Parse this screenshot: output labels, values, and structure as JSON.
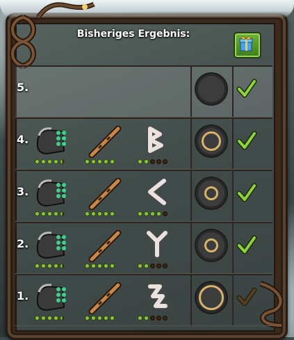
{
  "panel": {
    "title": "Bisheriges Ergebnis:"
  },
  "rows": [
    {
      "label": "5.",
      "blank": true,
      "checked": true
    },
    {
      "label": "4.",
      "rune": "rune-b-icon",
      "tool_dots": [
        2,
        2,
        2,
        2,
        1
      ],
      "staff_dots": [
        2,
        2,
        2,
        2,
        2
      ],
      "rune_dots": [
        2,
        2,
        0,
        0,
        0
      ],
      "ring": "small",
      "checked": true
    },
    {
      "label": "3.",
      "rune": "rune-c-icon",
      "tool_dots": [
        2,
        2,
        2,
        2,
        1
      ],
      "staff_dots": [
        2,
        2,
        2,
        2,
        2
      ],
      "rune_dots": [
        2,
        2,
        2,
        2,
        0
      ],
      "ring": "tiny",
      "checked": true
    },
    {
      "label": "2.",
      "rune": "rune-y-icon",
      "tool_dots": [
        2,
        2,
        2,
        2,
        1
      ],
      "staff_dots": [
        2,
        2,
        2,
        2,
        2
      ],
      "rune_dots": [
        2,
        2,
        0,
        0,
        0
      ],
      "ring": "tiny",
      "checked": true
    },
    {
      "label": "1.",
      "rune": "rune-s-icon",
      "tool_dots": [
        2,
        2,
        2,
        2,
        1
      ],
      "staff_dots": [
        2,
        2,
        2,
        2,
        2
      ],
      "rune_dots": [
        2,
        2,
        0,
        0,
        0
      ],
      "ring": "large",
      "checked": false
    }
  ],
  "colors": {
    "dot_on": "#8bc53a",
    "dot_off": "#3a2414",
    "check_on": "#8fd23a",
    "check_off": "#5a3a2a"
  }
}
